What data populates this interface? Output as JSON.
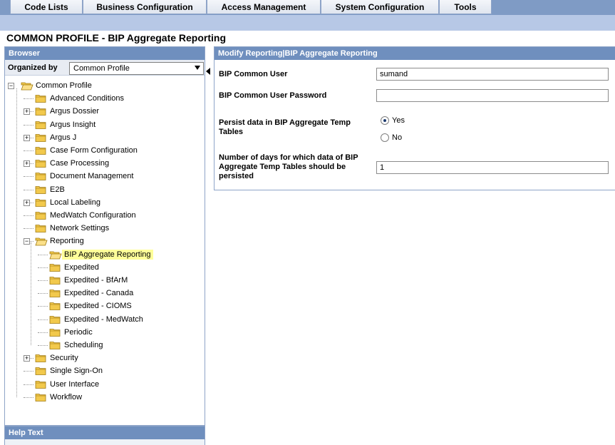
{
  "menu": [
    {
      "label": "Code Lists"
    },
    {
      "label": "Business Configuration"
    },
    {
      "label": "Access Management"
    },
    {
      "label": "System Configuration"
    },
    {
      "label": "Tools"
    }
  ],
  "page": {
    "title": "COMMON PROFILE - BIP Aggregate Reporting"
  },
  "browser": {
    "header": "Browser",
    "organized_by_label": "Organized by",
    "organized_by_value": "Common Profile",
    "tree": [
      {
        "label": "Common Profile",
        "level": 0,
        "expander": "minus",
        "open": true
      },
      {
        "label": "Advanced Conditions",
        "level": 1,
        "expander": ""
      },
      {
        "label": "Argus Dossier",
        "level": 1,
        "expander": "plus"
      },
      {
        "label": "Argus Insight",
        "level": 1,
        "expander": ""
      },
      {
        "label": "Argus J",
        "level": 1,
        "expander": "plus"
      },
      {
        "label": "Case Form Configuration",
        "level": 1,
        "expander": ""
      },
      {
        "label": "Case Processing",
        "level": 1,
        "expander": "plus"
      },
      {
        "label": "Document Management",
        "level": 1,
        "expander": ""
      },
      {
        "label": "E2B",
        "level": 1,
        "expander": ""
      },
      {
        "label": "Local Labeling",
        "level": 1,
        "expander": "plus"
      },
      {
        "label": "MedWatch Configuration",
        "level": 1,
        "expander": ""
      },
      {
        "label": "Network Settings",
        "level": 1,
        "expander": ""
      },
      {
        "label": "Reporting",
        "level": 1,
        "expander": "minus",
        "open": true
      },
      {
        "label": "BIP Aggregate Reporting",
        "level": 2,
        "expander": "",
        "open": true,
        "selected": true
      },
      {
        "label": "Expedited",
        "level": 2,
        "expander": ""
      },
      {
        "label": "Expedited - BfArM",
        "level": 2,
        "expander": ""
      },
      {
        "label": "Expedited - Canada",
        "level": 2,
        "expander": ""
      },
      {
        "label": "Expedited - CIOMS",
        "level": 2,
        "expander": ""
      },
      {
        "label": "Expedited - MedWatch",
        "level": 2,
        "expander": ""
      },
      {
        "label": "Periodic",
        "level": 2,
        "expander": ""
      },
      {
        "label": "Scheduling",
        "level": 2,
        "expander": ""
      },
      {
        "label": "Security",
        "level": 1,
        "expander": "plus"
      },
      {
        "label": "Single Sign-On",
        "level": 1,
        "expander": ""
      },
      {
        "label": "User Interface",
        "level": 1,
        "expander": ""
      },
      {
        "label": "Workflow",
        "level": 1,
        "expander": ""
      }
    ]
  },
  "help": {
    "header": "Help Text"
  },
  "form": {
    "header": "Modify Reporting|BIP Aggregate Reporting",
    "common_user_label": "BIP Common User",
    "common_user_value": "sumand",
    "password_label": "BIP Common User Password",
    "password_value": "",
    "persist_label": "Persist data in BIP Aggregate Temp Tables",
    "persist_yes_label": "Yes",
    "persist_no_label": "No",
    "persist_selected": "Yes",
    "days_label": "Number of days for which data of BIP Aggregate Temp Tables should be persisted",
    "days_value": "1"
  },
  "colors": {
    "menubar": "#7f9bc5",
    "subbar": "#b7c8e6",
    "panel_header": "#6f8fbe",
    "selected_highlight": "#ffff99",
    "folder": "#f2c94c"
  }
}
